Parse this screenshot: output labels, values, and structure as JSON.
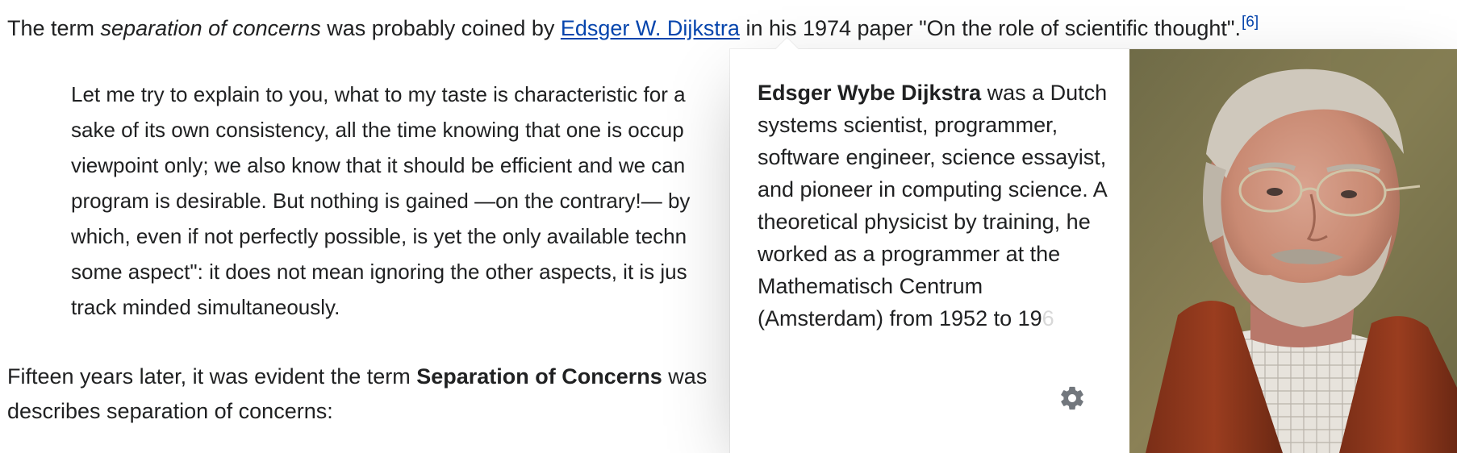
{
  "article": {
    "p1": {
      "t1": "The term ",
      "italic": "separation of concerns",
      "t2": " was probably coined by ",
      "link": "Edsger W. Dijkstra",
      "t3": " in his 1974 paper \"On the role of scientific thought\".",
      "cite": "[6]"
    },
    "quote": [
      "Let me try to explain to you, what to my taste is characteristic for a",
      "sake of its own consistency, all the time knowing that one is occup",
      "viewpoint only; we also know that it should be efficient and we can",
      "program is desirable. But nothing is gained —on the contrary!— by",
      "which, even if not perfectly possible, is yet the only available techn",
      "some aspect\": it does not mean ignoring the other aspects, it is jus",
      "track minded simultaneously."
    ],
    "p3": {
      "t1": "Fifteen years later, it was evident the term ",
      "bold": "Separation of Concerns",
      "t2": " was",
      "line2": "describes separation of concerns:"
    }
  },
  "popup": {
    "name_bold": "Edsger Wybe Dijkstra",
    "extract": " was a Dutch systems scientist, programmer, software engineer, science essayist, and pioneer in computing science. A theoretical physicist by training, he worked as a programmer at the Mathematisch Centrum (Amsterdam) from 1952 to 19",
    "fade_tail": "6",
    "settings_icon": "gear-icon",
    "image": "portrait-photo"
  },
  "colors": {
    "link": "#0645ad",
    "text": "#202122",
    "gear": "#72777d"
  }
}
